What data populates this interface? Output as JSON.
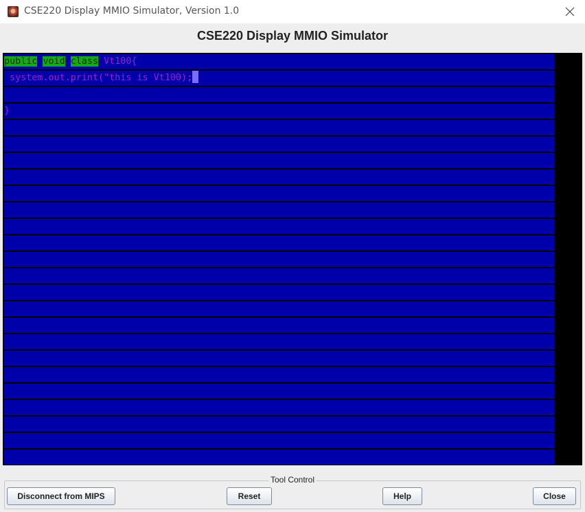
{
  "window": {
    "title": "CSE220 Display MMIO Simulator, Version 1.0",
    "close_icon": "close-icon",
    "app_icon": "app-icon"
  },
  "header": {
    "title": "CSE220 Display MMIO Simulator"
  },
  "display": {
    "row_bg": "#0000AA",
    "text_color": "#9B1FC7",
    "keyword_bg": "#14AA14",
    "cursor_color": "#7A6CFF",
    "row_count": 25,
    "line1": {
      "kw1": "public",
      "kw2": "void",
      "kw3": "class",
      "rest": "Vt100{"
    },
    "line2": {
      "text": " system.out.print(\"this is Vt100);"
    },
    "line3": {
      "text": ""
    },
    "line4": {
      "text": "}"
    }
  },
  "tool_control": {
    "label": "Tool Control",
    "disconnect_label": "Disconnect from MIPS",
    "reset_label": "Reset",
    "help_label": "Help",
    "close_label": "Close"
  }
}
